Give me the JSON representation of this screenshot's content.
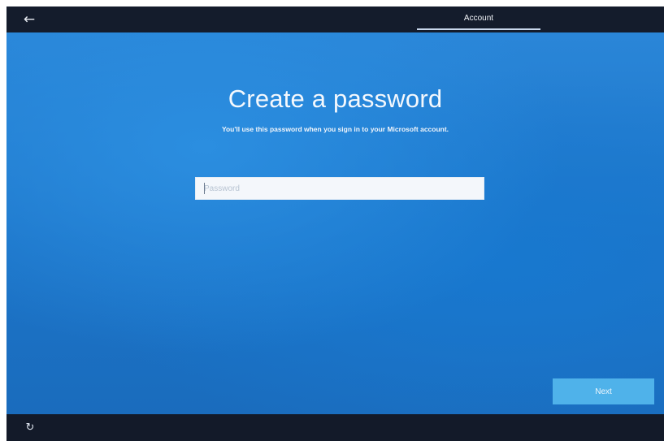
{
  "header": {
    "back_icon": "arrow-left-icon",
    "back_glyph": "←",
    "tab_label": "Account"
  },
  "main": {
    "title": "Create a password",
    "subtitle": "You'll use this password when you sign in to your Microsoft account.",
    "password_placeholder": "Password",
    "next_label": "Next"
  },
  "footer": {
    "accessibility_icon": "ease-of-access-icon",
    "accessibility_glyph": "↻"
  },
  "colors": {
    "background_blue": "#1c74c8",
    "next_button": "#4fb2ea",
    "chrome_dark": "#141c2c"
  }
}
